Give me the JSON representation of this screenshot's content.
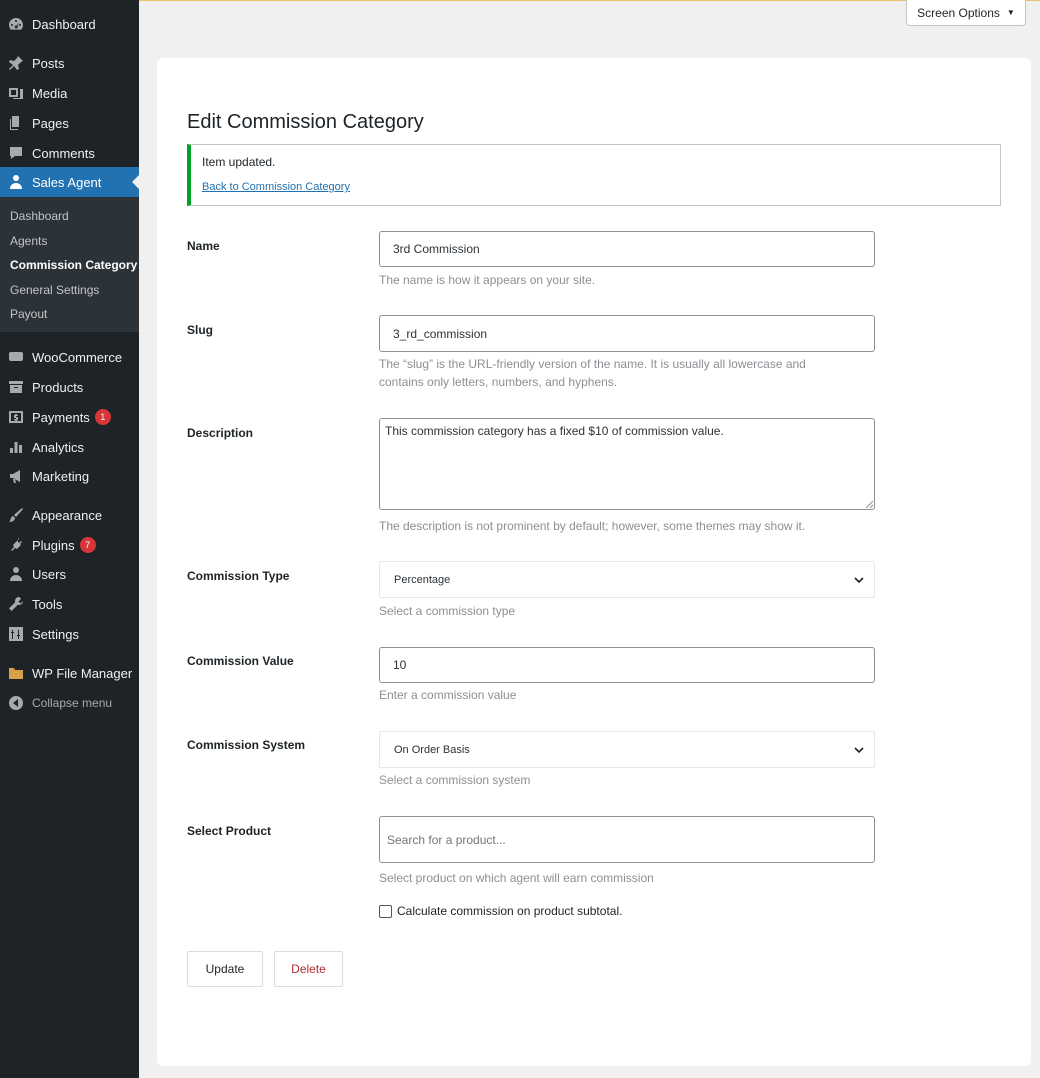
{
  "sidebar": {
    "items": {
      "dashboard": "Dashboard",
      "posts": "Posts",
      "media": "Media",
      "pages": "Pages",
      "comments": "Comments",
      "sales_agent": "Sales Agent",
      "woocommerce": "WooCommerce",
      "products": "Products",
      "payments": "Payments",
      "analytics": "Analytics",
      "marketing": "Marketing",
      "appearance": "Appearance",
      "plugins": "Plugins",
      "users": "Users",
      "tools": "Tools",
      "settings": "Settings",
      "wp_file_manager": "WP File Manager",
      "collapse": "Collapse menu"
    },
    "badges": {
      "payments": "1",
      "plugins": "7"
    },
    "submenu": {
      "dashboard": "Dashboard",
      "agents": "Agents",
      "commission_category": "Commission Category",
      "general_settings": "General Settings",
      "payout": "Payout"
    }
  },
  "header": {
    "screen_options": "Screen Options"
  },
  "page": {
    "title": "Edit Commission Category",
    "notice": {
      "message": "Item updated.",
      "back_link": "Back to Commission Category"
    }
  },
  "form": {
    "name": {
      "label": "Name",
      "value": "3rd Commission",
      "hint": "The name is how it appears on your site."
    },
    "slug": {
      "label": "Slug",
      "value": "3_rd_commission",
      "hint_line1": "The “slug” is the URL-friendly version of the name. It is usually all lowercase and",
      "hint_line2": "contains only letters, numbers, and hyphens."
    },
    "description": {
      "label": "Description",
      "value": "This commission category has a fixed $10 of commission value.",
      "hint": "The description is not prominent by default; however, some themes may show it."
    },
    "commission_type": {
      "label": "Commission Type",
      "value": "Percentage",
      "hint": "Select a commission type"
    },
    "commission_value": {
      "label": "Commission Value",
      "value": "10",
      "hint": "Enter a commission value"
    },
    "commission_system": {
      "label": "Commission System",
      "value": "On Order Basis",
      "hint": "Select a commission system"
    },
    "select_product": {
      "label": "Select Product",
      "placeholder": "Search for a product...",
      "hint": "Select product on which agent will earn commission"
    },
    "calc_subtotal_label": "Calculate commission on product subtotal."
  },
  "actions": {
    "update": "Update",
    "delete": "Delete"
  },
  "colors": {
    "sidebar_bg": "#1d2327",
    "active_menu": "#2271b1",
    "notice_success": "#00a32a",
    "delete_text": "#b32d2e",
    "badge": "#d63638"
  }
}
